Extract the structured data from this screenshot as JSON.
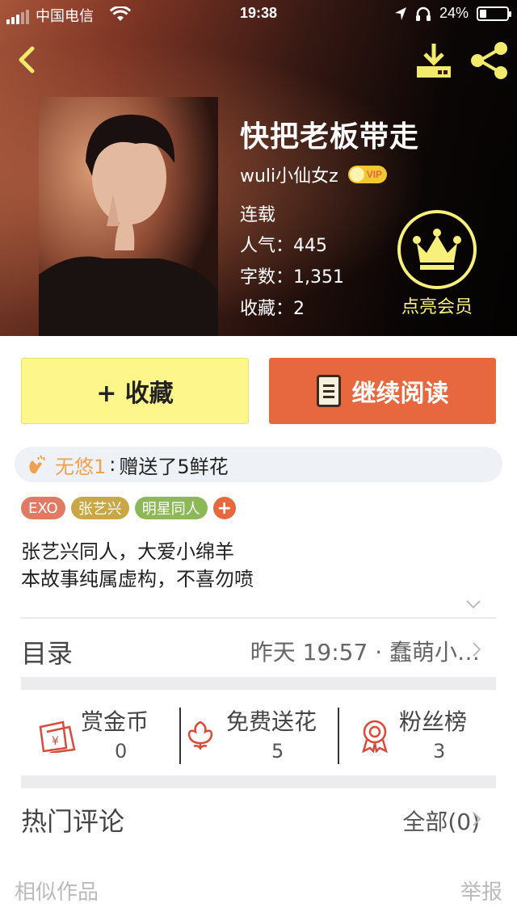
{
  "status_bar": {
    "carrier": "中国电信",
    "time": "19:38",
    "battery": "24%",
    "battery_level": 0.24
  },
  "nav": {
    "back_icon": "chevron-left-icon",
    "download_icon": "download-icon",
    "share_icon": "share-icon"
  },
  "book": {
    "title": "快把老板带走",
    "author": "wuli小仙女z",
    "vip_badge": "VIP",
    "status": "连载",
    "popularity": "人气：445",
    "word_count": "字数：1,351",
    "favorites": "收藏：2"
  },
  "member": {
    "label": "点亮会员",
    "icon": "crown-icon",
    "color": "#f7f07a"
  },
  "actions": {
    "favorite_label": "+ 收藏",
    "continue_label": "继续阅读",
    "favorite_color": "#fdf68a",
    "continue_color": "#e7683f"
  },
  "gift": {
    "user": "无悠1",
    "separator": ":",
    "message": "赠送了5鲜花"
  },
  "tags": [
    {
      "label": "EXO",
      "color": "#e07a62"
    },
    {
      "label": "张艺兴",
      "color": "#c9a646"
    },
    {
      "label": "明星同人",
      "color": "#8db858"
    },
    {
      "label": "+",
      "color": "#e7683f"
    }
  ],
  "description": {
    "line1": "张艺兴同人，大爱小绵羊",
    "line2": "本故事纯属虚构，不喜勿喷"
  },
  "toc": {
    "label": "目录",
    "latest": "昨天 19:57 · 蠢萌小…"
  },
  "stats": [
    {
      "label": "赏金币",
      "value": "0",
      "icon": "red-envelope-icon"
    },
    {
      "label": "免费送花",
      "value": "5",
      "icon": "flower-icon"
    },
    {
      "label": "粉丝榜",
      "value": "3",
      "icon": "medal-icon"
    }
  ],
  "comments": {
    "label": "热门评论",
    "all": "全部(0)"
  },
  "footer": {
    "similar": "相似作品",
    "report": "举报"
  }
}
